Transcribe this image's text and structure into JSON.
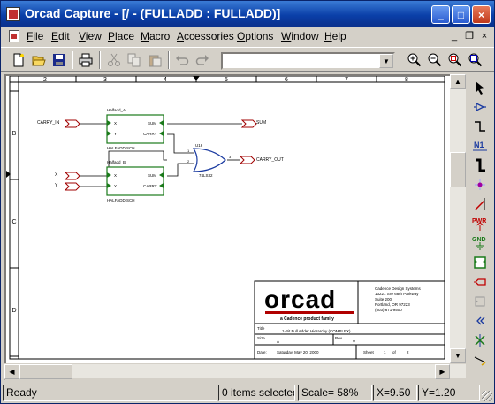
{
  "window": {
    "title": "Orcad Capture - [/ - (FULLADD : FULLADD)]",
    "controls": {
      "minimize": "_",
      "maximize": "□",
      "close": "×"
    }
  },
  "menu": {
    "items": [
      {
        "label": "File"
      },
      {
        "label": "Edit"
      },
      {
        "label": "View"
      },
      {
        "label": "Place"
      },
      {
        "label": "Macro"
      },
      {
        "label": "Accessories"
      },
      {
        "label": "Options"
      },
      {
        "label": "Window"
      },
      {
        "label": "Help"
      }
    ],
    "mdi": {
      "minimize": "_",
      "restore": "❐",
      "close": "×"
    }
  },
  "toolbar": {
    "combo_value": "",
    "icons": [
      "new-icon",
      "open-icon",
      "save-icon",
      "print-icon",
      "cut-icon",
      "copy-icon",
      "paste-icon",
      "undo-icon",
      "redo-icon",
      "zoom-in-icon",
      "zoom-out-icon",
      "zoom-area-icon",
      "zoom-all-icon"
    ]
  },
  "schematic": {
    "ruler": {
      "columns": [
        "2",
        "3",
        "4",
        "5",
        "6",
        "7",
        "8"
      ],
      "rows": [
        "B",
        "C",
        "D"
      ]
    },
    "ports": {
      "carry_in": "CARRY_IN",
      "x": "X",
      "y": "Y",
      "sum": "SUM",
      "carry_out": "CARRY_OUT"
    },
    "block_a": {
      "name": "Halfadd_A",
      "file": "HALFADD.SCH",
      "pins": {
        "x": "X",
        "y": "Y",
        "sum": "SUM",
        "carry": "CARRY"
      }
    },
    "block_b": {
      "name": "Halfadd_B",
      "file": "HALFADD.SCH",
      "pins": {
        "x": "X",
        "y": "Y",
        "sum": "SUM",
        "carry": "CARRY"
      }
    },
    "gate": {
      "ref": "U16",
      "part": "74LS32",
      "pin1": "1",
      "pin2": "2",
      "pin3": "3"
    },
    "title_block": {
      "logo": "orcad",
      "tagline": "a Cadence product family",
      "company": [
        "Cadence Design Systems",
        "13221 SW 68th Parkway",
        "Suite 200",
        "Portland, OR 97223",
        "(503) 671-9500"
      ],
      "title_label": "Title",
      "title_value": "1-Bit Full Adder Hierarchy (COMPLEX)",
      "size_label": "Size",
      "size_value": "A",
      "doc_label": "Document Number",
      "doc_value": "",
      "rev_label": "Rev",
      "rev_value": "V",
      "date_label": "Date:",
      "date_value": "Saturday, May 20, 2000",
      "sheet_label": "Sheet",
      "sheet_value": "1",
      "of_label": "of",
      "of_value": "2"
    }
  },
  "palette": {
    "icons": [
      "select-icon",
      "place-part-icon",
      "place-wire-icon",
      "net-alias-icon",
      "place-bus-icon",
      "junction-icon",
      "bus-entry-icon",
      "power-icon",
      "ground-icon",
      "hierarchical-block-icon",
      "hierarchical-port-icon",
      "hierarchical-pin-icon",
      "off-page-connector-icon",
      "no-connect-icon",
      "line-icon",
      "polyline-icon"
    ],
    "power_label": "PWR",
    "ground_label": "GND",
    "net_alias_label": "N1"
  },
  "status": {
    "ready": "Ready",
    "items_selected": "0 items selected",
    "scale": "Scale= 58%",
    "coord_x": "X=9.50",
    "coord_y": "Y=1.20"
  }
}
